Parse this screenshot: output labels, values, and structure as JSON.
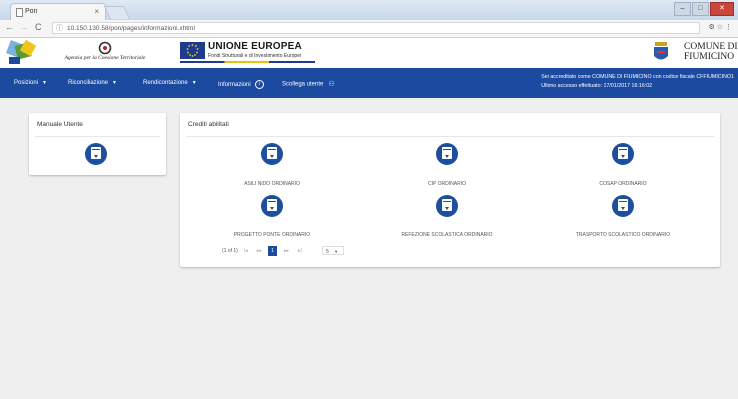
{
  "browser": {
    "tab_title": "Pon",
    "tab_close": "×",
    "url": "10.150.130.58/pon/pages/informazioni.xhtml",
    "nav_icons": [
      "←",
      "→",
      "C"
    ],
    "right_icons": "⚙ ☆ ⋮",
    "window_controls": [
      "–",
      "□",
      "✕"
    ]
  },
  "header": {
    "agency_text": "Agenzia per la Coesione Territoriale",
    "eu_title": "UNIONE EUROPEA",
    "eu_subtitle": "Fondi Strutturali e di Investimento Europei",
    "comune_line1": "COMUNE DI",
    "comune_line2": "FIUMICINO"
  },
  "navbar": {
    "items": [
      {
        "label": "Posizioni"
      },
      {
        "label": "Riconciliazione"
      },
      {
        "label": "Rendicontazione"
      },
      {
        "label": "Informazioni"
      },
      {
        "label": "Scollega utente"
      }
    ],
    "user_line1": "Sei accreditato come COMUNE DI FIUMICINO con codice fiscale CFFIUMICINO1",
    "user_line2": "Ultimo accesso effettuato: 17/01/2017 16:16:02"
  },
  "manual_card": {
    "title": "Manuale Utente"
  },
  "credits_card": {
    "title": "Crediti abilitati",
    "items": [
      {
        "label": "ASILI NIDO ORDINARIO"
      },
      {
        "label": "CIP ORDINARIO"
      },
      {
        "label": "COSAP ORDINARIO"
      },
      {
        "label": "PROGETTO PONTE ORDINARIO"
      },
      {
        "label": "REFEZIONE SCOLASTICA ORDINARIO"
      },
      {
        "label": "TRASPORTO SCOLASTICO ORDINARIO"
      }
    ]
  },
  "pagination": {
    "info": "(1 of 1)",
    "first": "|◂",
    "prev": "◂◂",
    "current": "1",
    "next": "▸▸",
    "last": "▸|",
    "rows": "5"
  }
}
